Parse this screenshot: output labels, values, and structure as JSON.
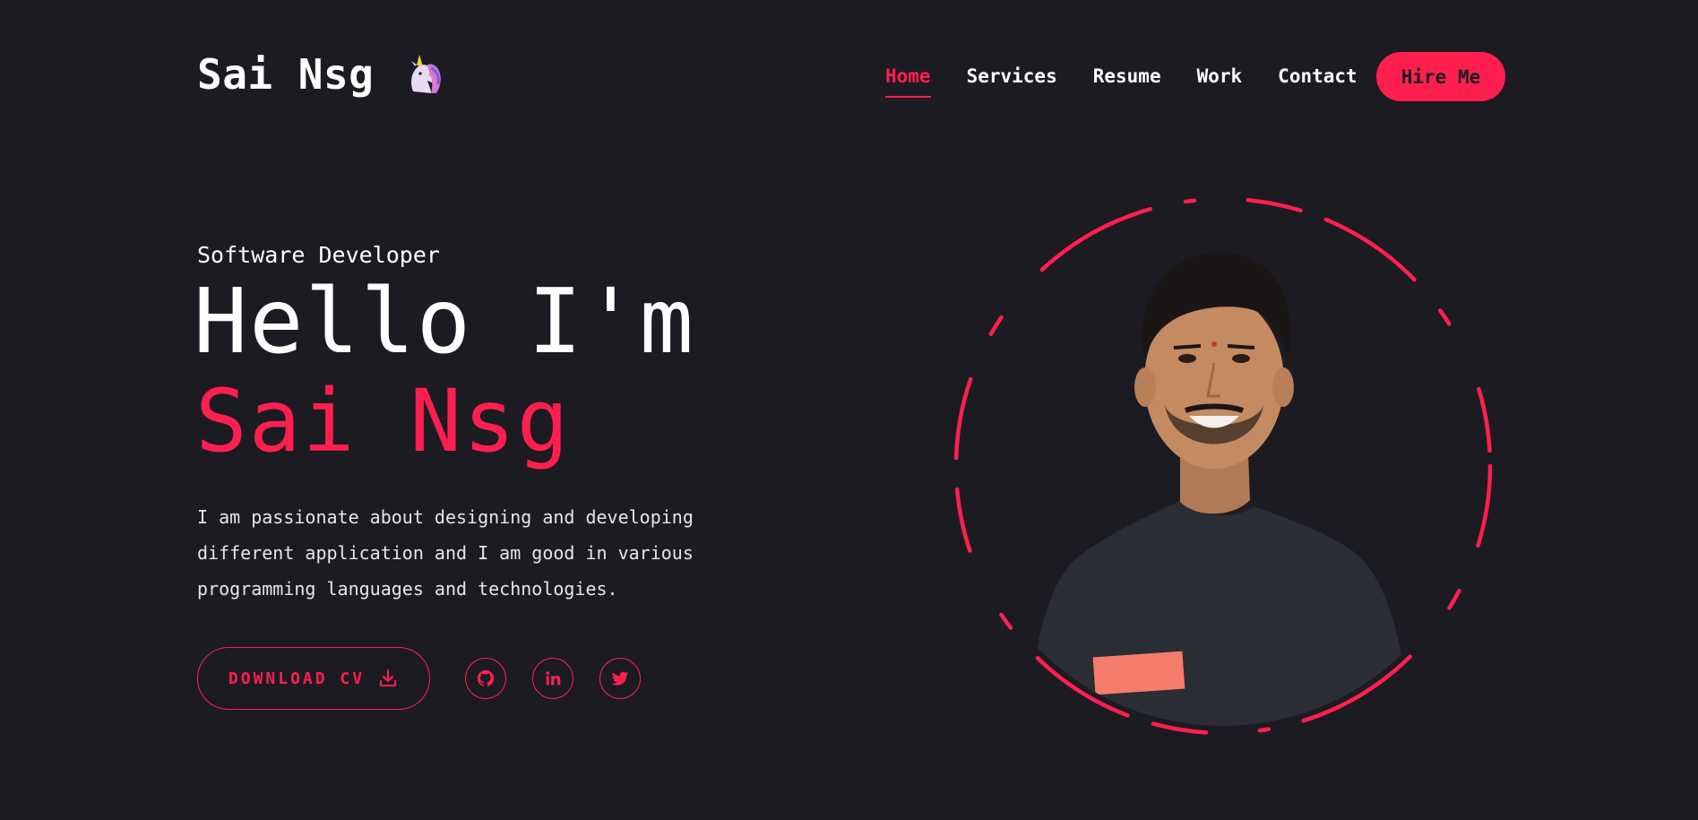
{
  "brand": {
    "name": "Sai Nsg",
    "logo_icon": "unicorn-icon"
  },
  "nav": {
    "items": [
      {
        "label": "Home",
        "active": true
      },
      {
        "label": "Services",
        "active": false
      },
      {
        "label": "Resume",
        "active": false
      },
      {
        "label": "Work",
        "active": false
      },
      {
        "label": "Contact",
        "active": false
      }
    ],
    "hire_label": "Hire Me"
  },
  "hero": {
    "role": "Software Developer",
    "greeting": "Hello I'm",
    "name": "Sai Nsg",
    "bio": "I am passionate about designing and developing different application and I am good in various programming languages and technologies.",
    "download_label": "DOWNLOAD CV",
    "download_icon": "download-icon",
    "socials": [
      {
        "name": "github",
        "icon": "github-icon"
      },
      {
        "name": "linkedin",
        "icon": "linkedin-icon"
      },
      {
        "name": "twitter",
        "icon": "twitter-icon"
      }
    ]
  },
  "portrait": {
    "icon": "profile-photo",
    "ring": "dashed-ring"
  },
  "colors": {
    "background": "#1c1b22",
    "accent": "#ff1f4f",
    "text": "#ffffff",
    "muted_text": "#e6e6ea"
  }
}
